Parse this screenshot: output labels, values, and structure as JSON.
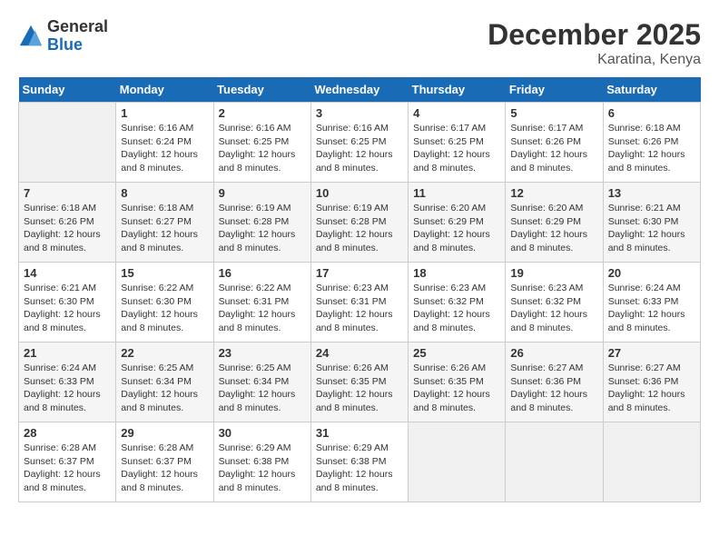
{
  "header": {
    "logo": {
      "general": "General",
      "blue": "Blue"
    },
    "title": "December 2025",
    "location": "Karatina, Kenya"
  },
  "calendar": {
    "weekdays": [
      "Sunday",
      "Monday",
      "Tuesday",
      "Wednesday",
      "Thursday",
      "Friday",
      "Saturday"
    ],
    "weeks": [
      [
        {
          "day": "",
          "sunrise": "",
          "sunset": "",
          "daylight": ""
        },
        {
          "day": "1",
          "sunrise": "Sunrise: 6:16 AM",
          "sunset": "Sunset: 6:24 PM",
          "daylight": "Daylight: 12 hours and 8 minutes."
        },
        {
          "day": "2",
          "sunrise": "Sunrise: 6:16 AM",
          "sunset": "Sunset: 6:25 PM",
          "daylight": "Daylight: 12 hours and 8 minutes."
        },
        {
          "day": "3",
          "sunrise": "Sunrise: 6:16 AM",
          "sunset": "Sunset: 6:25 PM",
          "daylight": "Daylight: 12 hours and 8 minutes."
        },
        {
          "day": "4",
          "sunrise": "Sunrise: 6:17 AM",
          "sunset": "Sunset: 6:25 PM",
          "daylight": "Daylight: 12 hours and 8 minutes."
        },
        {
          "day": "5",
          "sunrise": "Sunrise: 6:17 AM",
          "sunset": "Sunset: 6:26 PM",
          "daylight": "Daylight: 12 hours and 8 minutes."
        },
        {
          "day": "6",
          "sunrise": "Sunrise: 6:18 AM",
          "sunset": "Sunset: 6:26 PM",
          "daylight": "Daylight: 12 hours and 8 minutes."
        }
      ],
      [
        {
          "day": "7",
          "sunrise": "Sunrise: 6:18 AM",
          "sunset": "Sunset: 6:26 PM",
          "daylight": "Daylight: 12 hours and 8 minutes."
        },
        {
          "day": "8",
          "sunrise": "Sunrise: 6:18 AM",
          "sunset": "Sunset: 6:27 PM",
          "daylight": "Daylight: 12 hours and 8 minutes."
        },
        {
          "day": "9",
          "sunrise": "Sunrise: 6:19 AM",
          "sunset": "Sunset: 6:28 PM",
          "daylight": "Daylight: 12 hours and 8 minutes."
        },
        {
          "day": "10",
          "sunrise": "Sunrise: 6:19 AM",
          "sunset": "Sunset: 6:28 PM",
          "daylight": "Daylight: 12 hours and 8 minutes."
        },
        {
          "day": "11",
          "sunrise": "Sunrise: 6:20 AM",
          "sunset": "Sunset: 6:29 PM",
          "daylight": "Daylight: 12 hours and 8 minutes."
        },
        {
          "day": "12",
          "sunrise": "Sunrise: 6:20 AM",
          "sunset": "Sunset: 6:29 PM",
          "daylight": "Daylight: 12 hours and 8 minutes."
        },
        {
          "day": "13",
          "sunrise": "Sunrise: 6:21 AM",
          "sunset": "Sunset: 6:30 PM",
          "daylight": "Daylight: 12 hours and 8 minutes."
        }
      ],
      [
        {
          "day": "14",
          "sunrise": "Sunrise: 6:21 AM",
          "sunset": "Sunset: 6:30 PM",
          "daylight": "Daylight: 12 hours and 8 minutes."
        },
        {
          "day": "15",
          "sunrise": "Sunrise: 6:22 AM",
          "sunset": "Sunset: 6:30 PM",
          "daylight": "Daylight: 12 hours and 8 minutes."
        },
        {
          "day": "16",
          "sunrise": "Sunrise: 6:22 AM",
          "sunset": "Sunset: 6:31 PM",
          "daylight": "Daylight: 12 hours and 8 minutes."
        },
        {
          "day": "17",
          "sunrise": "Sunrise: 6:23 AM",
          "sunset": "Sunset: 6:31 PM",
          "daylight": "Daylight: 12 hours and 8 minutes."
        },
        {
          "day": "18",
          "sunrise": "Sunrise: 6:23 AM",
          "sunset": "Sunset: 6:32 PM",
          "daylight": "Daylight: 12 hours and 8 minutes."
        },
        {
          "day": "19",
          "sunrise": "Sunrise: 6:23 AM",
          "sunset": "Sunset: 6:32 PM",
          "daylight": "Daylight: 12 hours and 8 minutes."
        },
        {
          "day": "20",
          "sunrise": "Sunrise: 6:24 AM",
          "sunset": "Sunset: 6:33 PM",
          "daylight": "Daylight: 12 hours and 8 minutes."
        }
      ],
      [
        {
          "day": "21",
          "sunrise": "Sunrise: 6:24 AM",
          "sunset": "Sunset: 6:33 PM",
          "daylight": "Daylight: 12 hours and 8 minutes."
        },
        {
          "day": "22",
          "sunrise": "Sunrise: 6:25 AM",
          "sunset": "Sunset: 6:34 PM",
          "daylight": "Daylight: 12 hours and 8 minutes."
        },
        {
          "day": "23",
          "sunrise": "Sunrise: 6:25 AM",
          "sunset": "Sunset: 6:34 PM",
          "daylight": "Daylight: 12 hours and 8 minutes."
        },
        {
          "day": "24",
          "sunrise": "Sunrise: 6:26 AM",
          "sunset": "Sunset: 6:35 PM",
          "daylight": "Daylight: 12 hours and 8 minutes."
        },
        {
          "day": "25",
          "sunrise": "Sunrise: 6:26 AM",
          "sunset": "Sunset: 6:35 PM",
          "daylight": "Daylight: 12 hours and 8 minutes."
        },
        {
          "day": "26",
          "sunrise": "Sunrise: 6:27 AM",
          "sunset": "Sunset: 6:36 PM",
          "daylight": "Daylight: 12 hours and 8 minutes."
        },
        {
          "day": "27",
          "sunrise": "Sunrise: 6:27 AM",
          "sunset": "Sunset: 6:36 PM",
          "daylight": "Daylight: 12 hours and 8 minutes."
        }
      ],
      [
        {
          "day": "28",
          "sunrise": "Sunrise: 6:28 AM",
          "sunset": "Sunset: 6:37 PM",
          "daylight": "Daylight: 12 hours and 8 minutes."
        },
        {
          "day": "29",
          "sunrise": "Sunrise: 6:28 AM",
          "sunset": "Sunset: 6:37 PM",
          "daylight": "Daylight: 12 hours and 8 minutes."
        },
        {
          "day": "30",
          "sunrise": "Sunrise: 6:29 AM",
          "sunset": "Sunset: 6:38 PM",
          "daylight": "Daylight: 12 hours and 8 minutes."
        },
        {
          "day": "31",
          "sunrise": "Sunrise: 6:29 AM",
          "sunset": "Sunset: 6:38 PM",
          "daylight": "Daylight: 12 hours and 8 minutes."
        },
        {
          "day": "",
          "sunrise": "",
          "sunset": "",
          "daylight": ""
        },
        {
          "day": "",
          "sunrise": "",
          "sunset": "",
          "daylight": ""
        },
        {
          "day": "",
          "sunrise": "",
          "sunset": "",
          "daylight": ""
        }
      ]
    ]
  }
}
